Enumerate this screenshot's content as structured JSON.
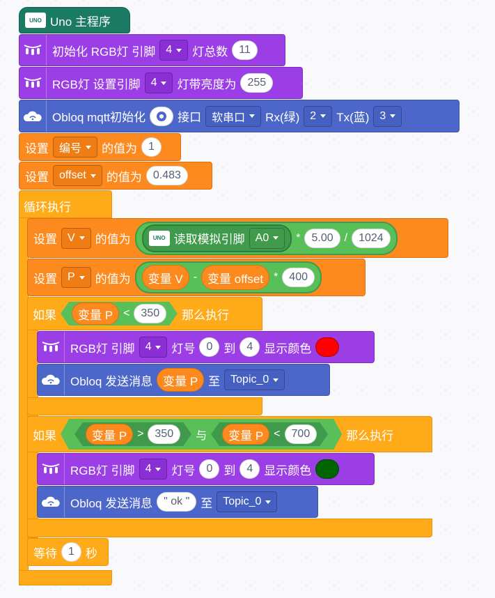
{
  "hat": {
    "label": "Uno 主程序"
  },
  "init_rgb": {
    "label": "初始化 RGB灯 引脚",
    "pin": "4",
    "count_label": "灯总数",
    "count": "11"
  },
  "rgb_brightness": {
    "label": "RGB灯 设置引脚",
    "pin": "4",
    "bright_label": "灯带亮度为",
    "value": "255"
  },
  "obloq_init": {
    "label": "Obloq mqtt初始化",
    "port_label": "接口",
    "port": "软串口",
    "rx_label": "Rx(绿)",
    "rx": "2",
    "tx_label": "Tx(蓝)",
    "tx": "3"
  },
  "set_num": {
    "set": "设置",
    "var": "编号",
    "value_label": "的值为",
    "value": "1"
  },
  "set_offset": {
    "set": "设置",
    "var": "offset",
    "value_label": "的值为",
    "value": "0.483"
  },
  "loop": {
    "label": "循环执行"
  },
  "set_v": {
    "set": "设置",
    "var": "V",
    "value_label": "的值为",
    "read_label": "读取模拟引脚",
    "pin": "A0",
    "mul": "*",
    "mul_val": "5.00",
    "div": "/",
    "div_val": "1024"
  },
  "set_p": {
    "set": "设置",
    "var": "P",
    "value_label": "的值为",
    "left": "变量 V",
    "minus": "-",
    "right": "变量 offset",
    "mul": "*",
    "mul_val": "400"
  },
  "if1": {
    "label": "如果",
    "var": "变量 P",
    "op": "<",
    "value": "350",
    "then": "那么执行"
  },
  "rgb1": {
    "label": "RGB灯 引脚",
    "pin": "4",
    "num_label": "灯号",
    "from": "0",
    "to_label": "到",
    "to": "4",
    "color_label": "显示颜色",
    "color": "#ff0000"
  },
  "send1": {
    "label": "Obloq 发送消息",
    "var": "变量 P",
    "to_label": "至",
    "topic": "Topic_0"
  },
  "if2": {
    "label": "如果",
    "var1": "变量 P",
    "op1": ">",
    "value1": "350",
    "and": "与",
    "var2": "变量 P",
    "op2": "<",
    "value2": "700",
    "then": "那么执行"
  },
  "rgb2": {
    "label": "RGB灯 引脚",
    "pin": "4",
    "num_label": "灯号",
    "from": "0",
    "to_label": "到",
    "to": "4",
    "color_label": "显示颜色",
    "color": "#006400"
  },
  "send2": {
    "label": "Obloq 发送消息",
    "msg": "\" ok \"",
    "to_label": "至",
    "topic": "Topic_0"
  },
  "wait": {
    "label": "等待",
    "value": "1",
    "unit": "秒"
  },
  "colors": {
    "purple": "#9b3ee5",
    "blue": "#4c67c9",
    "orange": "#fd8a1f",
    "gold": "#ffab19",
    "teal": "#1a7a62",
    "green": "#5cb85c"
  }
}
